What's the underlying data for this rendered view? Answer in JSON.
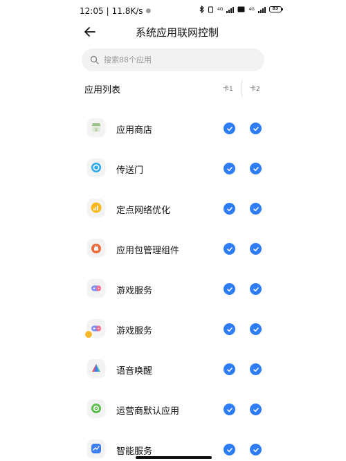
{
  "status_bar": {
    "time": "12:05",
    "separator": "|",
    "speed": "11.8K/s",
    "net_label_1": "4G",
    "net_label_2": "4G",
    "battery": "83"
  },
  "header": {
    "title": "系统应用联网控制"
  },
  "search": {
    "placeholder": "搜索88个应用"
  },
  "list": {
    "title": "应用列表",
    "col_sim1": "卡1",
    "col_sim2": "卡2"
  },
  "apps": [
    {
      "label": "应用商店",
      "icon": "store-icon",
      "sim1": true,
      "sim2": true
    },
    {
      "label": "传送门",
      "icon": "portal-icon",
      "sim1": true,
      "sim2": true
    },
    {
      "label": "定点网络优化",
      "icon": "network-optimize-icon",
      "sim1": true,
      "sim2": true
    },
    {
      "label": "应用包管理组件",
      "icon": "package-manager-icon",
      "sim1": true,
      "sim2": true
    },
    {
      "label": "游戏服务",
      "icon": "gamepad-icon",
      "sim1": true,
      "sim2": true
    },
    {
      "label": "游戏服务",
      "icon": "gamepad-badge-icon",
      "sim1": true,
      "sim2": true
    },
    {
      "label": "语音唤醒",
      "icon": "voice-wake-icon",
      "sim1": true,
      "sim2": true
    },
    {
      "label": "运营商默认应用",
      "icon": "carrier-gear-icon",
      "sim1": true,
      "sim2": true
    },
    {
      "label": "智能服务",
      "icon": "smart-service-icon",
      "sim1": true,
      "sim2": true
    }
  ],
  "colors": {
    "accent": "#2f7df6",
    "search_bg": "#f2f2f2"
  }
}
